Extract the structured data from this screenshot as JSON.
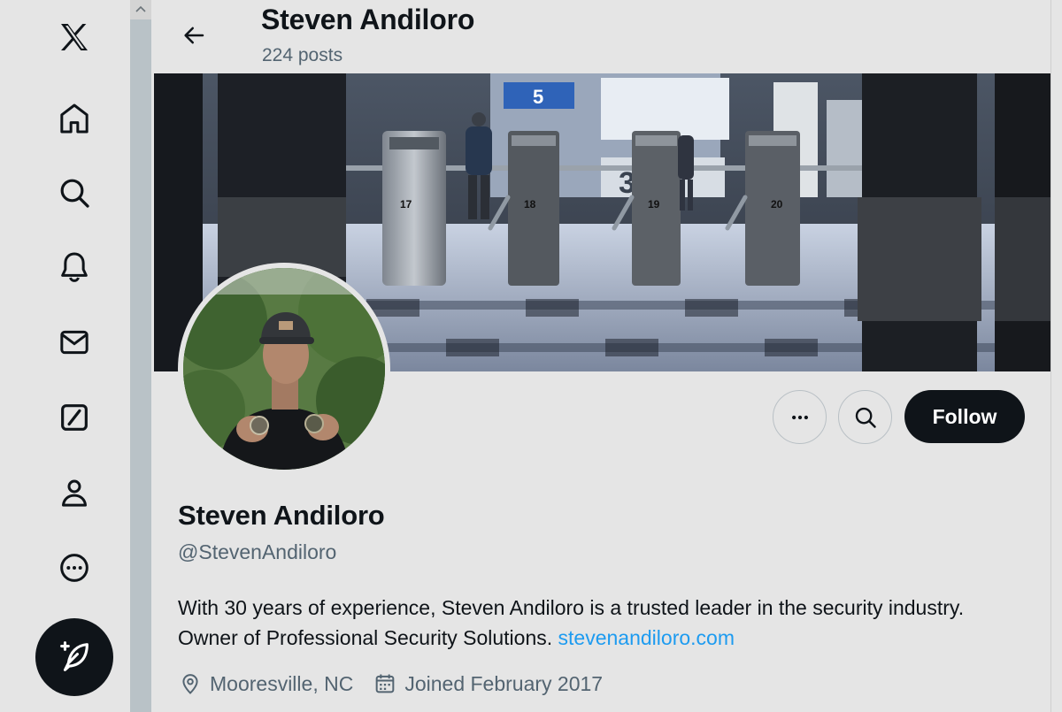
{
  "header": {
    "title": "Steven Andiloro",
    "posts": "224 posts"
  },
  "nav": {
    "items": [
      "x-logo-icon",
      "home-icon",
      "search-icon",
      "notifications-icon",
      "messages-icon",
      "grok-icon",
      "profile-icon",
      "more-icon",
      "compose-icon"
    ]
  },
  "profile": {
    "name": "Steven Andiloro",
    "handle": "@StevenAndiloro",
    "bio_text": "With 30 years of experience, Steven Andiloro is a trusted leader in the security industry. Owner of Professional Security Solutions. ",
    "bio_link": "stevenandiloro.com",
    "location": "Mooresville, NC",
    "joined": "Joined February 2017"
  },
  "actions": {
    "follow_label": "Follow",
    "more_icon": "more-horizontal-icon",
    "search_icon": "search-icon"
  },
  "banner": {
    "signs": [
      "5",
      "3",
      "17",
      "18",
      "19",
      "20"
    ]
  },
  "colors": {
    "background": "#e5e5e5",
    "text": "#0f1419",
    "secondary": "#536471",
    "link": "#1d9bf0",
    "button": "#0f1419"
  }
}
